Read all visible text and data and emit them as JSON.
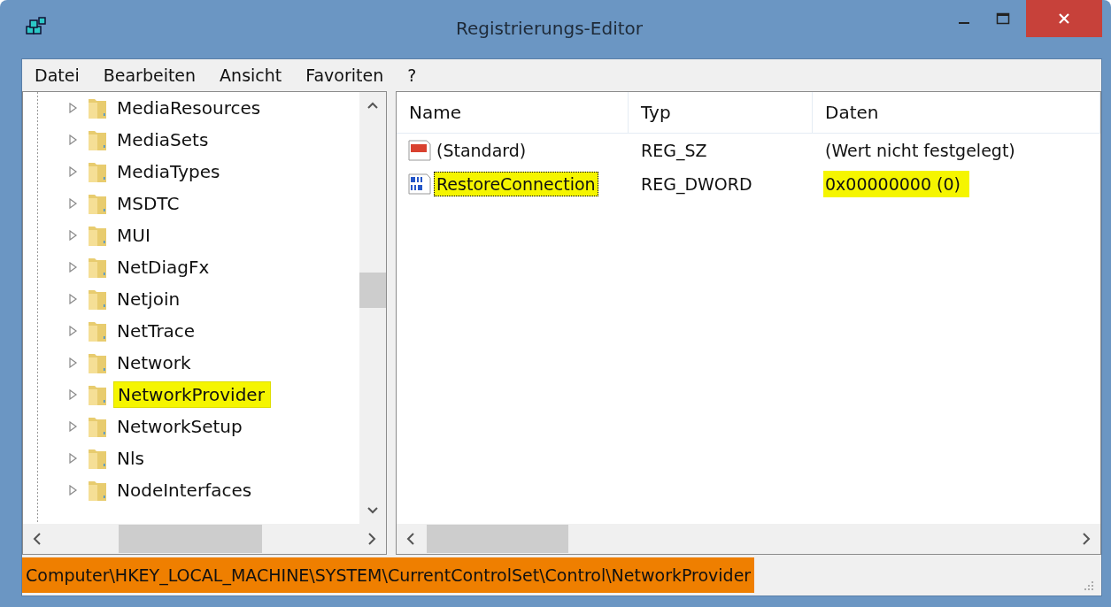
{
  "window": {
    "title": "Registrierungs-Editor"
  },
  "menu": [
    "Datei",
    "Bearbeiten",
    "Ansicht",
    "Favoriten",
    "?"
  ],
  "tree": {
    "items": [
      {
        "label": "MediaResources",
        "highlighted": false
      },
      {
        "label": "MediaSets",
        "highlighted": false
      },
      {
        "label": "MediaTypes",
        "highlighted": false
      },
      {
        "label": "MSDTC",
        "highlighted": false
      },
      {
        "label": "MUI",
        "highlighted": false
      },
      {
        "label": "NetDiagFx",
        "highlighted": false
      },
      {
        "label": "Netjoin",
        "highlighted": false
      },
      {
        "label": "NetTrace",
        "highlighted": false
      },
      {
        "label": "Network",
        "highlighted": false
      },
      {
        "label": "NetworkProvider",
        "highlighted": true
      },
      {
        "label": "NetworkSetup",
        "highlighted": false
      },
      {
        "label": "Nls",
        "highlighted": false
      },
      {
        "label": "NodeInterfaces",
        "highlighted": false
      }
    ]
  },
  "values": {
    "columns": [
      "Name",
      "Typ",
      "Daten"
    ],
    "rows": [
      {
        "kind": "string",
        "name": "(Standard)",
        "type": "REG_SZ",
        "data": "(Wert nicht festgelegt)",
        "selected": false,
        "data_highlighted": false
      },
      {
        "kind": "binary",
        "name": "RestoreConnection",
        "type": "REG_DWORD",
        "data": "0x00000000 (0)",
        "selected": true,
        "data_highlighted": true
      }
    ]
  },
  "status_bar": {
    "path": "Computer\\HKEY_LOCAL_MACHINE\\SYSTEM\\CurrentControlSet\\Control\\NetworkProvider",
    "highlighted": true
  }
}
